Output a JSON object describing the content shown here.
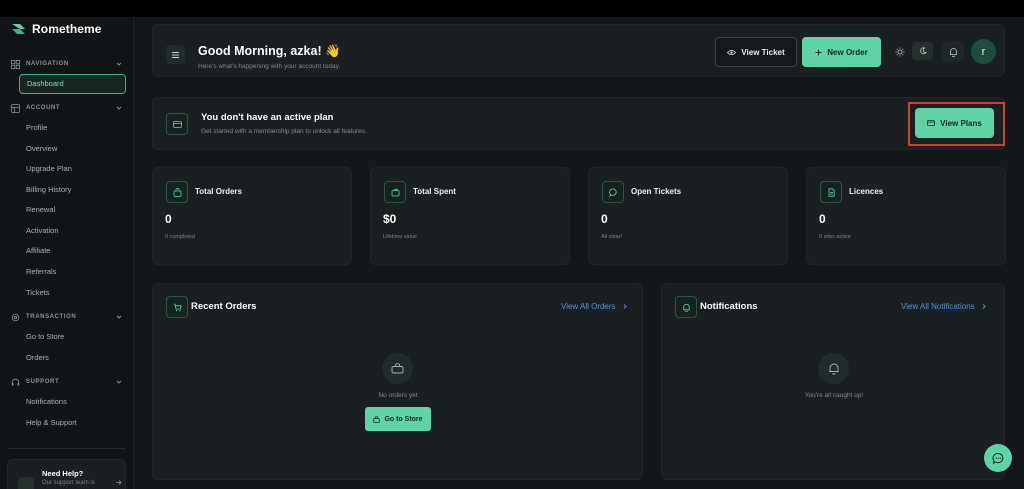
{
  "brand": {
    "name": "Rometheme"
  },
  "sidebar": {
    "sections": [
      {
        "label": "NAVIGATION",
        "icon": "grid-icon"
      },
      {
        "label": "ACCOUNT",
        "icon": "user-square-icon"
      },
      {
        "label": "TRANSACTION",
        "icon": "gear-icon"
      },
      {
        "label": "SUPPORT",
        "icon": "headset-icon"
      }
    ],
    "active_item": "Dashboard",
    "account_items": [
      "Profile",
      "Overview",
      "Upgrade Plan",
      "Billing History",
      "Renewal",
      "Activation",
      "Affiliate",
      "Referrals",
      "Tickets"
    ],
    "transaction_items": [
      "Go to Store",
      "Orders"
    ],
    "support_items": [
      "Notifications",
      "Help & Support"
    ],
    "help": {
      "title": "Need Help?",
      "subtitle": "Our support team is"
    }
  },
  "header": {
    "greeting": "Good Morning, azka! 👋",
    "subtitle": "Here's what's happening with your account today.",
    "view_ticket": "View Ticket",
    "new_order": "New Order",
    "avatar_initial": "r"
  },
  "plan": {
    "title": "You don't have an active plan",
    "subtitle": "Get started with a membership plan to unlock all features.",
    "button": "View Plans"
  },
  "stats": [
    {
      "label": "Total Orders",
      "value": "0",
      "sub": "0 completed",
      "icon": "bag-icon"
    },
    {
      "label": "Total Spent",
      "value": "$0",
      "sub": "Lifetime value",
      "icon": "wallet-icon"
    },
    {
      "label": "Open Tickets",
      "value": "0",
      "sub": "All clear!",
      "icon": "chat-icon"
    },
    {
      "label": "Licences",
      "value": "0",
      "sub": "0 sites active",
      "icon": "document-icon"
    }
  ],
  "orders": {
    "title": "Recent Orders",
    "link": "View All Orders",
    "empty_text": "No orders yet",
    "button": "Go to Store"
  },
  "notifications": {
    "title": "Notifications",
    "link": "View All Notifications",
    "empty_text": "You're all caught up!"
  },
  "colors": {
    "accent": "#5fd3a6",
    "highlight": "#d2402d",
    "link": "#5a8fd6",
    "background": "#14181b",
    "card": "#1a1f22"
  }
}
